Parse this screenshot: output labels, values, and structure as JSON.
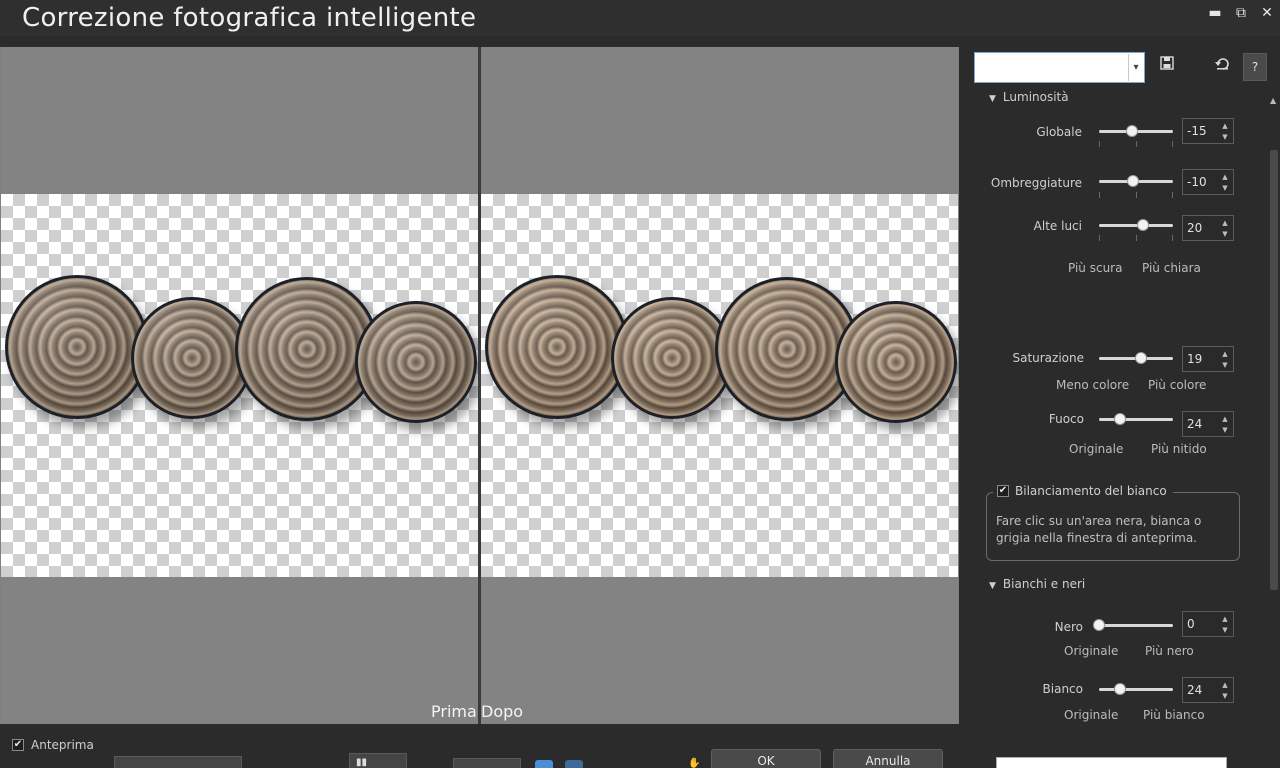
{
  "window": {
    "title": "Correzione fotografica intelligente",
    "controls": {
      "minimize": "▬",
      "restore": "⧉",
      "close": "✕"
    }
  },
  "preview": {
    "before_label": "Prima",
    "after_label": "Dopo"
  },
  "panel": {
    "preset_value": "",
    "luminosita": {
      "header": "Luminosità",
      "globale": {
        "label": "Globale",
        "value": "-15",
        "level": 0.44
      },
      "ombreggiature": {
        "label": "Ombreggiature",
        "value": "-10",
        "level": 0.46
      },
      "alte_luci": {
        "label": "Alte luci",
        "value": "20",
        "level": 0.59
      },
      "left_hint": "Più scura",
      "right_hint": "Più chiara"
    },
    "saturazione": {
      "label": "Saturazione",
      "value": "19",
      "level": 0.57,
      "left_hint": "Meno colore",
      "right_hint": "Più colore"
    },
    "fuoco": {
      "label": "Fuoco",
      "value": "24",
      "level": 0.28,
      "left_hint": "Originale",
      "right_hint": "Più nitido"
    },
    "bilanciamento": {
      "label": "Bilanciamento del bianco",
      "checked": "✔",
      "description": "Fare clic su un'area nera, bianca o grigia nella finestra di anteprima."
    },
    "bianchi_neri": {
      "header": "Bianchi e neri",
      "nero": {
        "label": "Nero",
        "value": "0",
        "level": 0.0,
        "left_hint": "Originale",
        "right_hint": "Più nero"
      },
      "bianco": {
        "label": "Bianco",
        "value": "24",
        "level": 0.28,
        "left_hint": "Originale",
        "right_hint": "Più bianco"
      }
    }
  },
  "footer": {
    "anteprima_label": "Anteprima",
    "anteprima_checked": "✔",
    "ok_label": "OK",
    "annulla_label": "Annulla",
    "blue_accent": "#4a90d9"
  }
}
